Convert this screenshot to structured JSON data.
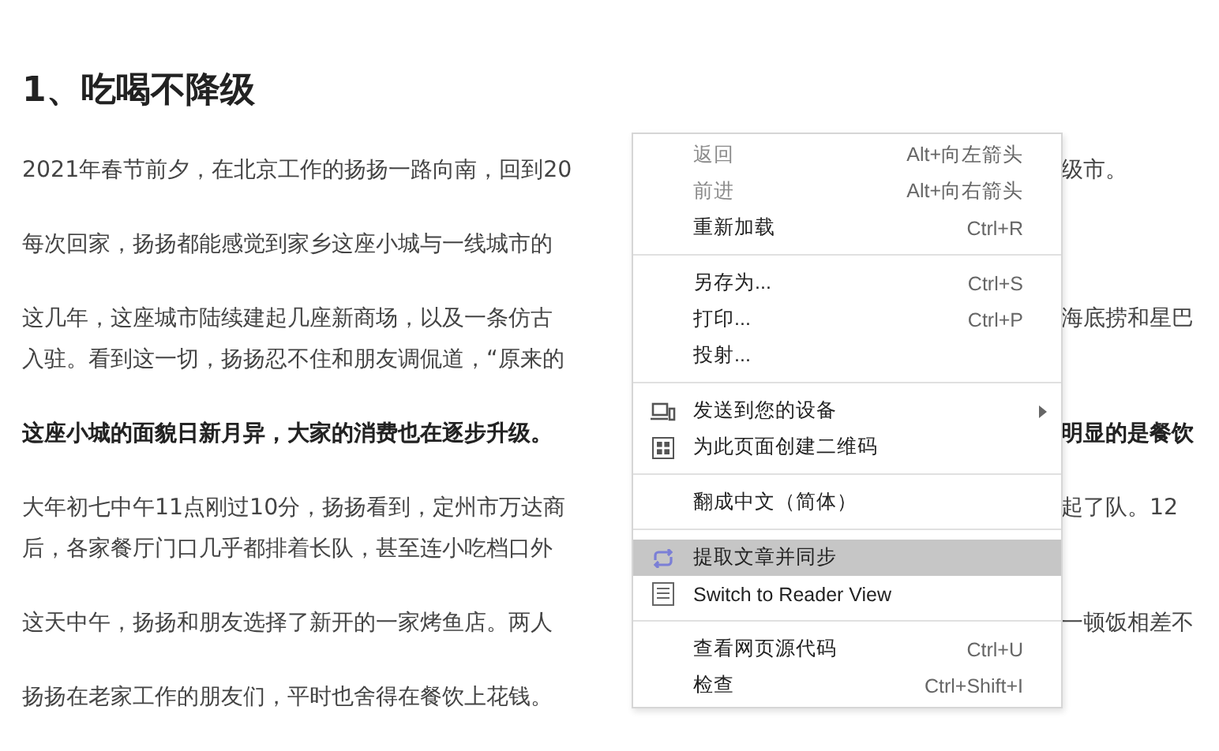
{
  "article": {
    "heading": "1、吃喝不降级",
    "paragraphs": [
      {
        "bold": false,
        "lines": [
          {
            "left": "2021年春节前夕，在北京工作的扬扬一路向南，回到20",
            "right": "级市。"
          }
        ]
      },
      {
        "bold": false,
        "lines": [
          {
            "left": "每次回家，扬扬都能感觉到家乡这座小城与一线城市的"
          }
        ]
      },
      {
        "bold": false,
        "lines": [
          {
            "left": "这几年，这座城市陆续建起几座新商场，以及一条仿古",
            "right": "海底捞和星巴"
          },
          {
            "left": "入驻。看到这一切，扬扬忍不住和朋友调侃道，“原来的"
          }
        ]
      },
      {
        "bold": true,
        "lines": [
          {
            "left": "这座小城的面貌日新月异，大家的消费也在逐步升级。",
            "right": "明显的是餐饮"
          }
        ]
      },
      {
        "bold": false,
        "lines": [
          {
            "left": "大年初七中午11点刚过10分，扬扬看到，定州市万达商",
            "right": "起了队。12"
          },
          {
            "left": "后，各家餐厅门口几乎都排着长队，甚至连小吃档口外"
          }
        ]
      },
      {
        "bold": false,
        "lines": [
          {
            "left": "这天中午，扬扬和朋友选择了新开的一家烤鱼店。两人",
            "right": "一顿饭相差不"
          }
        ]
      },
      {
        "bold": false,
        "lines": [
          {
            "left": "扬扬在老家工作的朋友们，平时也舍得在餐饮上花钱。"
          }
        ]
      }
    ]
  },
  "context_menu": {
    "items": [
      {
        "kind": "item",
        "label": "返回",
        "shortcut": "Alt+向左箭头",
        "disabled": true,
        "selected": false
      },
      {
        "kind": "item",
        "label": "前进",
        "shortcut": "Alt+向右箭头",
        "disabled": true,
        "selected": false
      },
      {
        "kind": "item",
        "label": "重新加载",
        "shortcut": "Ctrl+R",
        "disabled": false,
        "selected": false
      },
      {
        "kind": "separator"
      },
      {
        "kind": "item",
        "label": "另存为...",
        "shortcut": "Ctrl+S",
        "disabled": false,
        "selected": false
      },
      {
        "kind": "item",
        "label": "打印...",
        "shortcut": "Ctrl+P",
        "disabled": false,
        "selected": false
      },
      {
        "kind": "item",
        "label": "投射...",
        "disabled": false,
        "selected": false
      },
      {
        "kind": "separator"
      },
      {
        "kind": "devices",
        "label": "发送到您的设备",
        "submenu": true,
        "disabled": false,
        "selected": false
      },
      {
        "kind": "qrcode",
        "label": "为此页面创建二维码",
        "disabled": false,
        "selected": false
      },
      {
        "kind": "separator"
      },
      {
        "kind": "item",
        "label": "翻成中文（简体）",
        "disabled": false,
        "selected": false
      },
      {
        "kind": "separator"
      },
      {
        "kind": "sync",
        "label": "提取文章并同步",
        "disabled": false,
        "selected": true
      },
      {
        "kind": "reader",
        "label": "Switch to Reader View",
        "disabled": false,
        "selected": false
      },
      {
        "kind": "separator"
      },
      {
        "kind": "item",
        "label": "查看网页源代码",
        "shortcut": "Ctrl+U",
        "disabled": false,
        "selected": false
      },
      {
        "kind": "item",
        "label": "检查",
        "shortcut": "Ctrl+Shift+I",
        "disabled": false,
        "selected": false
      }
    ]
  }
}
